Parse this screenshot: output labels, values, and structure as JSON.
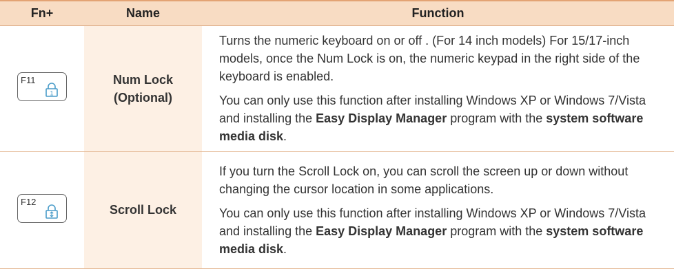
{
  "headers": {
    "fn": "Fn+",
    "name": "Name",
    "function": "Function"
  },
  "rows": [
    {
      "key_label": "F11",
      "key_icon": "num-lock-icon",
      "name_line1": "Num Lock",
      "name_line2": "(Optional)",
      "para1": "Turns the numeric keyboard on or off . (For 14 inch models) For 15/17-inch models, once the Num Lock is on, the numeric keypad in the right side of the keyboard is enabled.",
      "para2_a": "You can only use this function after installing Windows XP or Windows 7/Vista and installing the ",
      "para2_b": "Easy Display Manager",
      "para2_c": " program with the ",
      "para2_d": "system software media disk",
      "para2_e": "."
    },
    {
      "key_label": "F12",
      "key_icon": "scroll-lock-icon",
      "name_line1": "Scroll Lock",
      "para1": "If you turn the Scroll Lock on, you can scroll the screen up or down without changing the cursor location in some applications.",
      "para2_a": "You can only use this function after installing Windows XP or Windows 7/Vista and installing the ",
      "para2_b": "Easy Display Manager",
      "para2_c": " program with the ",
      "para2_d": "system software media disk",
      "para2_e": "."
    }
  ],
  "colors": {
    "header_bg": "#f8dcc3",
    "name_col_bg": "#fdf0e4",
    "rule": "#e4b894"
  }
}
